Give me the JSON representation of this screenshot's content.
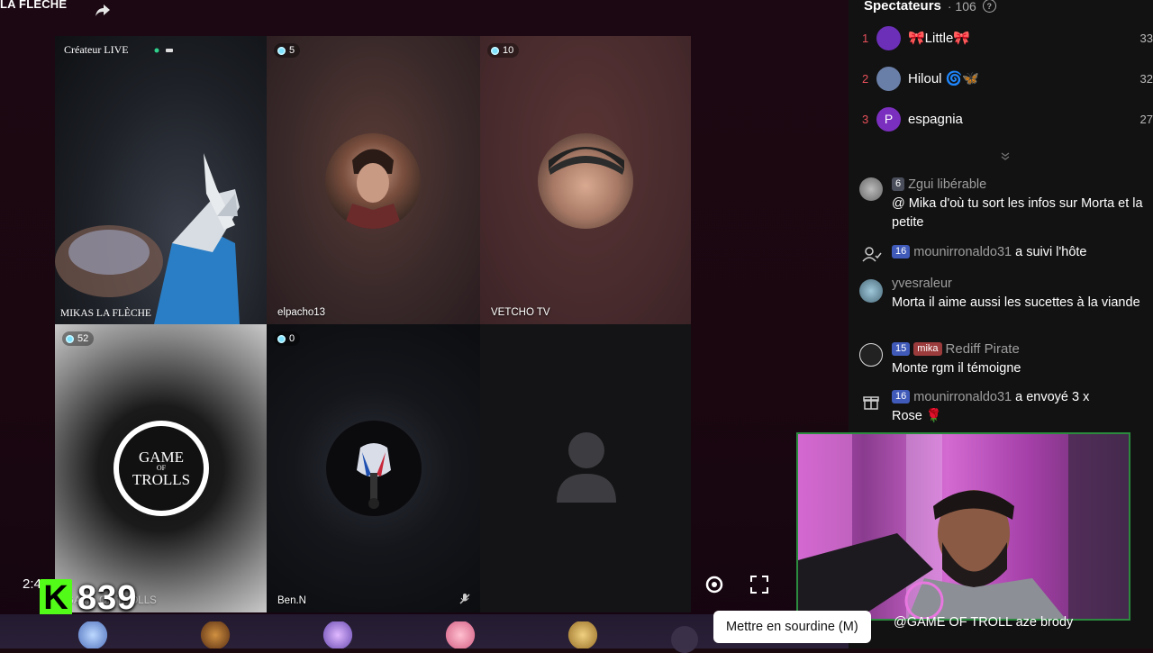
{
  "stage": {
    "host_name": "LA FLÈCHE",
    "timer": "2:41:30",
    "counter": "839",
    "k_logo": "K"
  },
  "tiles": [
    {
      "label": "Créateur LIVE",
      "name": "MIKAS LA FLÈCHE"
    },
    {
      "badge": "5",
      "name": "elpacho13"
    },
    {
      "badge": "10",
      "name": "VETCHO TV"
    },
    {
      "badge": "52",
      "name": "GAME OF TROLLS",
      "logo_top": "GAME",
      "logo_of": "OF",
      "logo_bottom": "TROLLS"
    },
    {
      "badge": "0",
      "name": "Ben.N"
    },
    {}
  ],
  "panel": {
    "title": "Spectateurs",
    "count": "· 106",
    "ranking": [
      {
        "rank": "1",
        "name": "🎀Little🎀",
        "score": "33",
        "avatar": "",
        "color": "#6b2fb8"
      },
      {
        "rank": "2",
        "name": "Hiloul 🌀🦋",
        "score": "32",
        "avatar": "",
        "color": "#6a7fa8"
      },
      {
        "rank": "3",
        "name": "espagnia",
        "score": "27",
        "avatar": "P",
        "color": "#7b2fbf"
      }
    ]
  },
  "chat": [
    {
      "level": "6",
      "user": "Zgui libérable",
      "text": "@ Mika d'où tu sort les infos sur Morta et la petite"
    },
    {
      "level": "16",
      "user": "mounirronaldo31",
      "text": "a suivi l'hôte"
    },
    {
      "user": "yvesraleur",
      "text": "Morta il aime aussi les sucettes à la viande"
    },
    {
      "level": "15",
      "fan": "mika",
      "user": "Rediff Pirate",
      "text": "Monte rgm il témoigne"
    },
    {
      "level": "16",
      "user": "mounirronaldo31",
      "text": "a envoyé 3 x",
      "text2": "Rose 🌹"
    }
  ],
  "tooltip": "Mettre en sourdine (M)",
  "bottom_chat": "@GAME OF TROLL aze brody"
}
